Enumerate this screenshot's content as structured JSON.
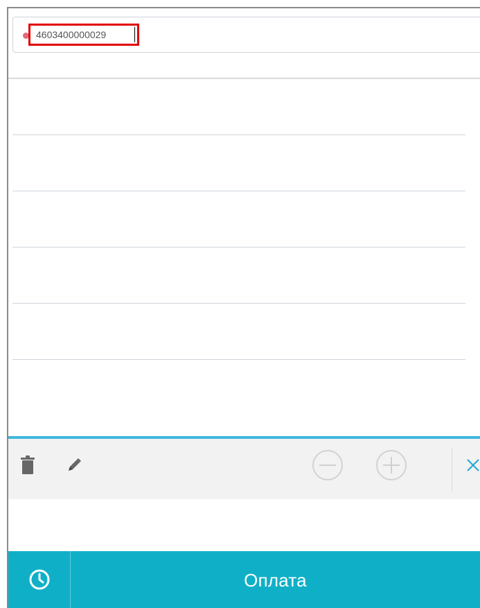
{
  "search": {
    "value": "4603400000029",
    "placeholder": ""
  },
  "list": {
    "rows": [
      {},
      {},
      {},
      {},
      {}
    ]
  },
  "toolbar": {
    "icons": {
      "delete": "trash-icon",
      "edit": "pencil-icon",
      "decrease": "minus-circle-icon",
      "increase": "plus-circle-icon",
      "close": "close-icon"
    }
  },
  "footer": {
    "history_icon": "clock-icon",
    "pay_label": "Оплата"
  },
  "colors": {
    "accent": "#41b7dd",
    "pay_bar": "#0fb0c7",
    "error_outline": "#e00000",
    "status_dot": "#e06c75",
    "close_icon": "#20a9d5"
  }
}
